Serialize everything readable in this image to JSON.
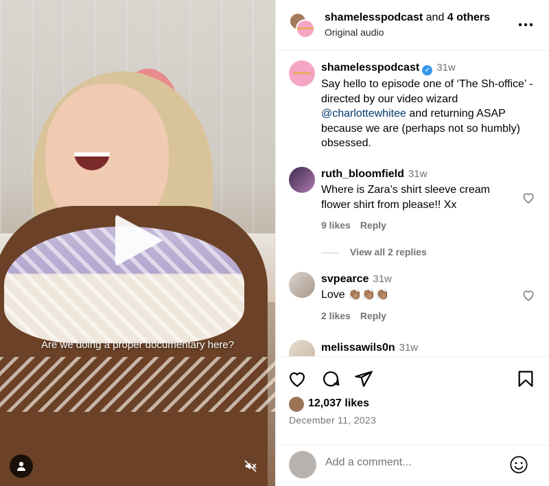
{
  "video": {
    "caption": "Are we doing a proper documentary here?",
    "play_icon": "play-icon",
    "user_icon": "person-icon",
    "mute_icon": "speaker-muted-icon"
  },
  "header": {
    "username": "shamelesspodcast",
    "and_text": "and",
    "others": "4 others",
    "audio": "Original audio",
    "more_icon": "more-icon"
  },
  "caption": {
    "username": "shamelesspodcast",
    "time": "31w",
    "text_before": "Say hello to episode one of ‘The Sh-office’ - directed by our video wizard ",
    "mention": "@charlottewhitee",
    "text_after": " and returning ASAP because we are (perhaps not so humbly) obsessed."
  },
  "comments": [
    {
      "username": "ruth_bloomfield",
      "time": "31w",
      "text": "Where is Zara’s shirt sleeve cream flower shirt from please!! Xx",
      "likes": "9 likes",
      "reply": "Reply",
      "view_replies": "View all 2 replies"
    },
    {
      "username": "svpearce",
      "time": "31w",
      "text": "Love 👏🏽👏🏽👏🏽",
      "likes": "2 likes",
      "reply": "Reply"
    },
    {
      "username": "melissawils0n",
      "time": "31w"
    }
  ],
  "actions": {
    "likes": "12,037 likes",
    "date": "December 11, 2023",
    "like_icon": "heart-icon",
    "comment_icon": "comment-icon",
    "share_icon": "share-icon",
    "save_icon": "bookmark-icon"
  },
  "comment_bar": {
    "placeholder": "Add a comment...",
    "emoji_icon": "emoji-icon"
  },
  "colors": {
    "accent_link": "#00376b",
    "verified": "#3897f0",
    "muted_text": "#737373"
  }
}
